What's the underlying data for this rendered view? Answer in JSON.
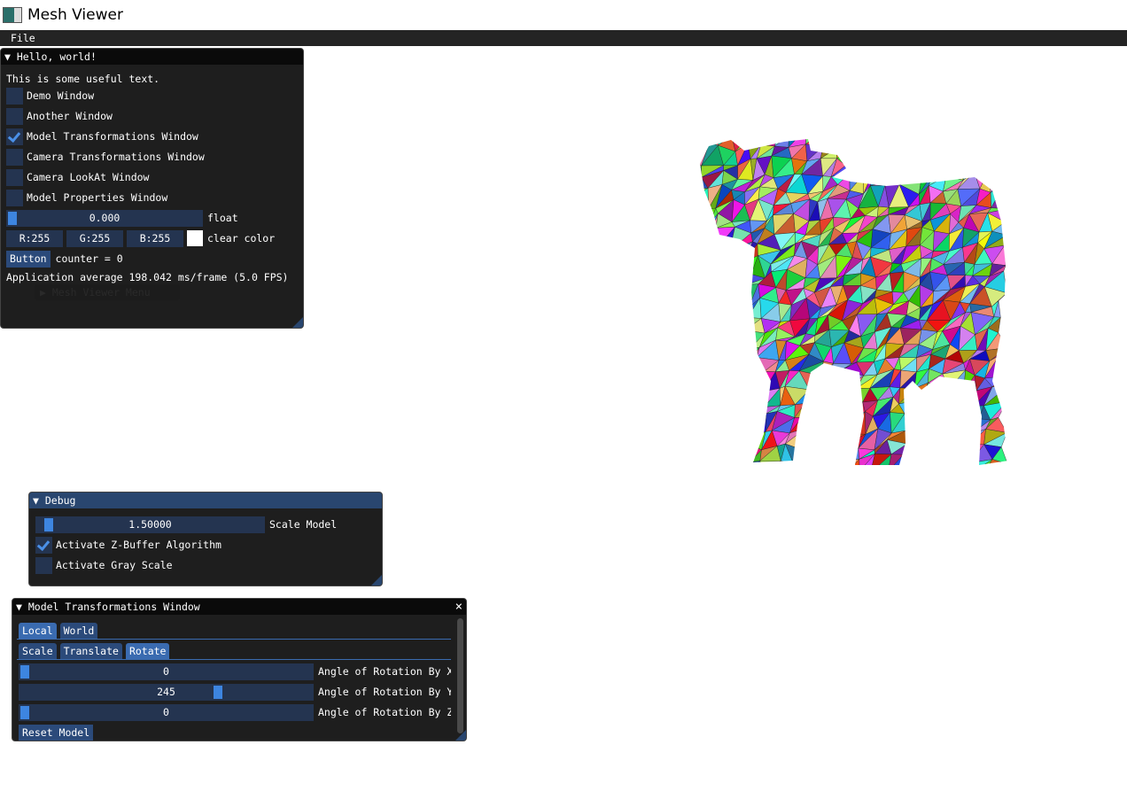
{
  "app": {
    "title": "Mesh Viewer",
    "icon": "app-window-icon"
  },
  "menu": {
    "file": "File"
  },
  "hello": {
    "title": "Hello, world!",
    "text": "This is some useful text.",
    "checkboxes": [
      {
        "label": "Demo Window",
        "checked": false
      },
      {
        "label": "Another Window",
        "checked": false
      },
      {
        "label": "Model Transformations Window",
        "checked": true
      },
      {
        "label": "Camera Transformations Window",
        "checked": false
      },
      {
        "label": "Camera LookAt Window",
        "checked": false
      },
      {
        "label": "Model Properties Window",
        "checked": false
      }
    ],
    "float_value": "0.000",
    "float_label": "float",
    "r": "R:255",
    "g": "G:255",
    "b": "B:255",
    "clear_color_label": "clear color",
    "clear_color": "#ffffff",
    "button": "Button",
    "counter": "counter = 0",
    "fps": "Application average 198.042 ms/frame (5.0 FPS)",
    "ghost_menu": "▶ Mesh Viewer Menu"
  },
  "debug": {
    "title": "Debug",
    "scale_value": "1.50000",
    "scale_label": "Scale Model",
    "zbuffer": "Activate Z-Buffer Algorithm",
    "zbuffer_checked": true,
    "gray": "Activate Gray Scale",
    "gray_checked": false
  },
  "model": {
    "title": "Model Transformations Window",
    "close": "×",
    "tabs": [
      "Local",
      "World"
    ],
    "subtabs": [
      "Scale",
      "Translate",
      "Rotate"
    ],
    "sliders": [
      {
        "value": "0",
        "fraction": 0,
        "label": "Angle of Rotation By X"
      },
      {
        "value": "245",
        "fraction": 0.68,
        "label": "Angle of Rotation By Y"
      },
      {
        "value": "0",
        "fraction": 0,
        "label": "Angle of Rotation By Z"
      }
    ],
    "reset": "Reset Model"
  }
}
